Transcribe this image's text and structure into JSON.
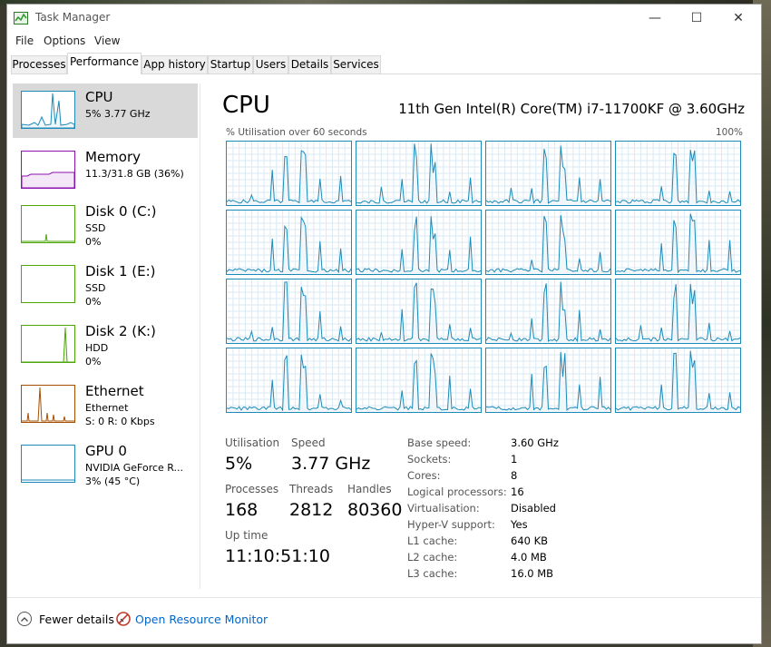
{
  "window": {
    "title": "Task Manager",
    "minimize": "—",
    "maximize": "☐",
    "close": "✕"
  },
  "menu": [
    "File",
    "Options",
    "View"
  ],
  "tabs": [
    "Processes",
    "Performance",
    "App history",
    "Startup",
    "Users",
    "Details",
    "Services"
  ],
  "active_tab": "Performance",
  "sidebar": [
    {
      "name": "CPU",
      "line2": "5% 3.77 GHz",
      "line3": "",
      "color": "#1c8bb9"
    },
    {
      "name": "Memory",
      "line2": "11.3/31.8 GB (36%)",
      "line3": "",
      "color": "#8b12ae"
    },
    {
      "name": "Disk 0 (C:)",
      "line2": "SSD",
      "line3": "0%",
      "color": "#4da60c"
    },
    {
      "name": "Disk 1 (E:)",
      "line2": "SSD",
      "line3": "0%",
      "color": "#4da60c"
    },
    {
      "name": "Disk 2 (K:)",
      "line2": "HDD",
      "line3": "0%",
      "color": "#4da60c"
    },
    {
      "name": "Ethernet",
      "line2": "Ethernet",
      "line3": "S: 0 R: 0 Kbps",
      "color": "#a74f01"
    },
    {
      "name": "GPU 0",
      "line2": "NVIDIA GeForce R...",
      "line3": "3% (45 °C)",
      "color": "#1c8bb9"
    }
  ],
  "main": {
    "title": "CPU",
    "model": "11th Gen Intel(R) Core(TM) i7-11700KF @ 3.60GHz",
    "util_caption": "% Utilisation over 60 seconds",
    "util_max": "100%"
  },
  "stats": {
    "utilisation_label": "Utilisation",
    "utilisation": "5%",
    "speed_label": "Speed",
    "speed": "3.77 GHz",
    "processes_label": "Processes",
    "processes": "168",
    "threads_label": "Threads",
    "threads": "2812",
    "handles_label": "Handles",
    "handles": "80360",
    "uptime_label": "Up time",
    "uptime": "11:10:51:10"
  },
  "details": [
    {
      "label": "Base speed:",
      "value": "3.60 GHz"
    },
    {
      "label": "Sockets:",
      "value": "1"
    },
    {
      "label": "Cores:",
      "value": "8"
    },
    {
      "label": "Logical processors:",
      "value": "16"
    },
    {
      "label": "Virtualisation:",
      "value": "Disabled"
    },
    {
      "label": "Hyper-V support:",
      "value": "Yes"
    },
    {
      "label": "L1 cache:",
      "value": "640 KB"
    },
    {
      "label": "L2 cache:",
      "value": "4.0 MB"
    },
    {
      "label": "L3 cache:",
      "value": "16.0 MB"
    }
  ],
  "footer": {
    "fewer_details": "Fewer details",
    "resource_monitor": "Open Resource Monitor"
  },
  "colors": {
    "cpu_line": "#1c8bb9",
    "cpu_fill": "#f1f6fa",
    "grid": "#d9eaf4",
    "link": "#0066cc"
  }
}
